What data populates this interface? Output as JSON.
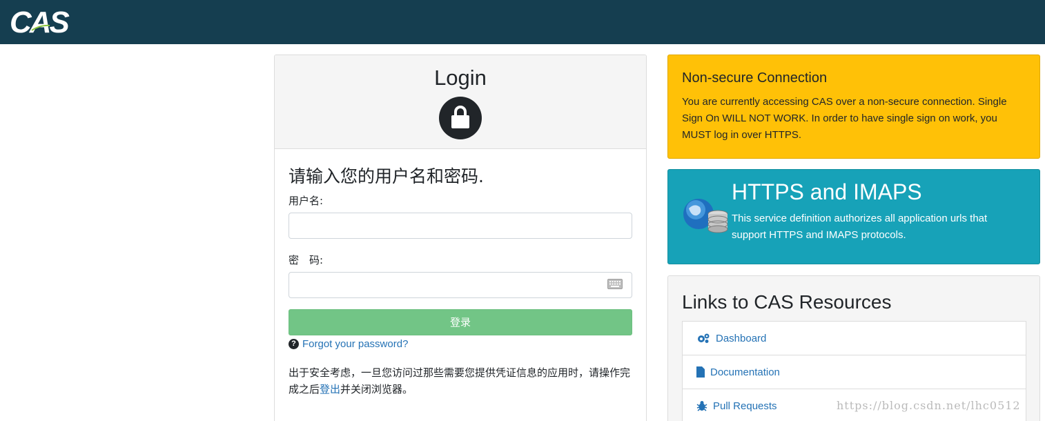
{
  "header": {
    "logo_text": "CAS"
  },
  "login": {
    "title": "Login",
    "prompt": "请输入您的用户名和密码.",
    "username_label": "用户名:",
    "password_label": "密　码:",
    "username_value": "",
    "password_value": "",
    "submit_label": "登录",
    "forgot_label": "Forgot your password?",
    "notice_before": "出于安全考虑，一旦您访问过那些需要您提供凭证信息的应用时，请操作完成之后",
    "notice_link": "登出",
    "notice_after": "并关闭浏览器。"
  },
  "warning": {
    "title": "Non-secure Connection",
    "body": "You are currently accessing CAS over a non-secure connection. Single Sign On WILL NOT WORK. In order to have single sign on work, you MUST log in over HTTPS."
  },
  "service": {
    "title": "HTTPS and IMAPS",
    "body": "This service definition authorizes all application urls that support HTTPS and IMAPS protocols."
  },
  "resources": {
    "title": "Links to CAS Resources",
    "items": [
      {
        "label": "Dashboard",
        "icon": "gears-icon"
      },
      {
        "label": "Documentation",
        "icon": "file-icon"
      },
      {
        "label": "Pull Requests",
        "icon": "bug-icon"
      }
    ]
  },
  "watermark": "https://blog.csdn.net/lhc0512",
  "colors": {
    "header": "#153e50",
    "warning": "#ffc107",
    "service": "#17a2b8",
    "login_button": "#72c586",
    "link": "#2472b5"
  }
}
